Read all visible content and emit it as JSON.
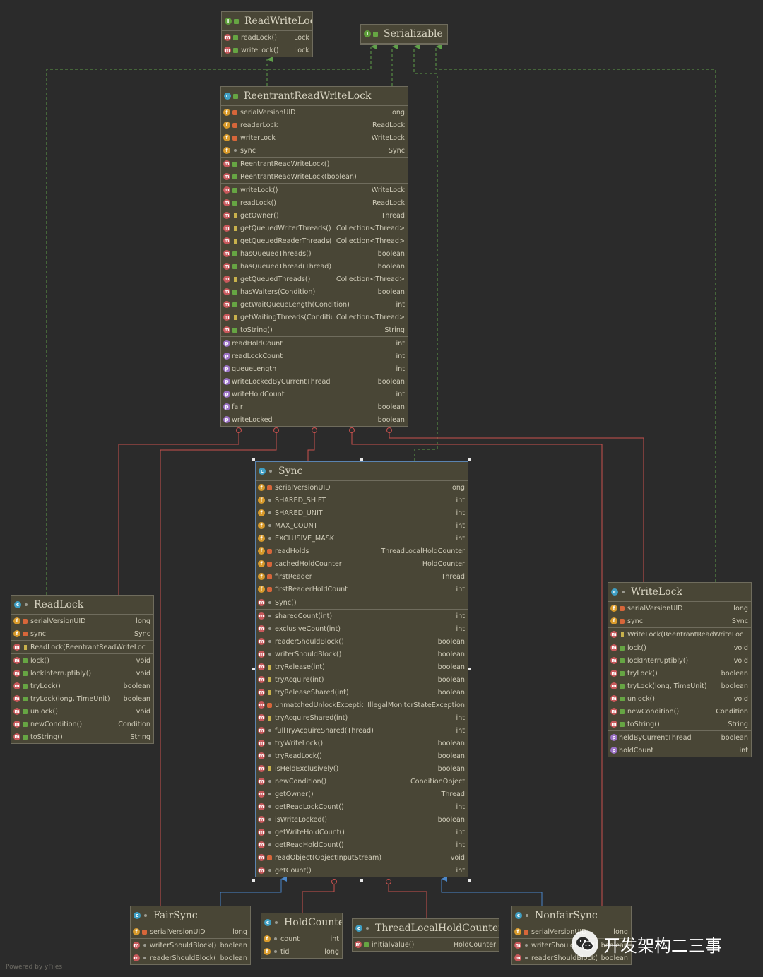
{
  "footer": "Powered by yFiles",
  "watermark": "开发架构二三事",
  "colors": {
    "background": "#2b2b2b",
    "box_fill": "#494636",
    "box_border": "#6f6c5d",
    "realize_edge": "#5f9f4a",
    "inner_edge": "#c9514e",
    "extends_edge": "#4a86c8"
  },
  "boxes": {
    "readwritelock": {
      "kind": "interface",
      "name": "ReadWriteLock",
      "sections": [
        [
          {
            "icon": "m",
            "vis": "pub",
            "label": "readLock()",
            "type": "Lock"
          },
          {
            "icon": "m",
            "vis": "pub",
            "label": "writeLock()",
            "type": "Lock"
          }
        ]
      ]
    },
    "serializable": {
      "kind": "interface",
      "name": "Serializable",
      "sections": []
    },
    "rrwl": {
      "kind": "class",
      "name": "ReentrantReadWriteLock",
      "sections": [
        [
          {
            "icon": "f",
            "vis": "priv",
            "label": "serialVersionUID",
            "type": "long"
          },
          {
            "icon": "f",
            "vis": "priv",
            "label": "readerLock",
            "type": "ReadLock"
          },
          {
            "icon": "f",
            "vis": "priv",
            "label": "writerLock",
            "type": "WriteLock"
          },
          {
            "icon": "f",
            "vis": "pack",
            "label": "sync",
            "type": "Sync"
          }
        ],
        [
          {
            "icon": "m",
            "vis": "pub",
            "label": "ReentrantReadWriteLock()",
            "type": ""
          },
          {
            "icon": "m",
            "vis": "pub",
            "label": "ReentrantReadWriteLock(boolean)",
            "type": ""
          }
        ],
        [
          {
            "icon": "m",
            "vis": "pub",
            "label": "writeLock()",
            "type": "WriteLock"
          },
          {
            "icon": "m",
            "vis": "pub",
            "label": "readLock()",
            "type": "ReadLock"
          },
          {
            "icon": "m",
            "vis": "prot",
            "label": "getOwner()",
            "type": "Thread"
          },
          {
            "icon": "m",
            "vis": "prot",
            "label": "getQueuedWriterThreads()",
            "type": "Collection<Thread>"
          },
          {
            "icon": "m",
            "vis": "prot",
            "label": "getQueuedReaderThreads()",
            "type": "Collection<Thread>"
          },
          {
            "icon": "m",
            "vis": "pub",
            "label": "hasQueuedThreads()",
            "type": "boolean"
          },
          {
            "icon": "m",
            "vis": "pub",
            "label": "hasQueuedThread(Thread)",
            "type": "boolean"
          },
          {
            "icon": "m",
            "vis": "prot",
            "label": "getQueuedThreads()",
            "type": "Collection<Thread>"
          },
          {
            "icon": "m",
            "vis": "pub",
            "label": "hasWaiters(Condition)",
            "type": "boolean"
          },
          {
            "icon": "m",
            "vis": "pub",
            "label": "getWaitQueueLength(Condition)",
            "type": "int"
          },
          {
            "icon": "m",
            "vis": "prot",
            "label": "getWaitingThreads(Condition)",
            "type": "Collection<Thread>"
          },
          {
            "icon": "m",
            "vis": "pub",
            "label": "toString()",
            "type": "String"
          }
        ],
        [
          {
            "icon": "p",
            "vis": "",
            "label": "readHoldCount",
            "type": "int"
          },
          {
            "icon": "p",
            "vis": "",
            "label": "readLockCount",
            "type": "int"
          },
          {
            "icon": "p",
            "vis": "",
            "label": "queueLength",
            "type": "int"
          },
          {
            "icon": "p",
            "vis": "",
            "label": "writeLockedByCurrentThread",
            "type": "boolean"
          },
          {
            "icon": "p",
            "vis": "",
            "label": "writeHoldCount",
            "type": "int"
          },
          {
            "icon": "p",
            "vis": "",
            "label": "fair",
            "type": "boolean"
          },
          {
            "icon": "p",
            "vis": "",
            "label": "writeLocked",
            "type": "boolean"
          }
        ]
      ]
    },
    "sync": {
      "kind": "class",
      "name": "Sync",
      "sections": [
        [
          {
            "icon": "f",
            "vis": "priv",
            "label": "serialVersionUID",
            "type": "long"
          },
          {
            "icon": "f",
            "vis": "pack",
            "label": "SHARED_SHIFT",
            "type": "int"
          },
          {
            "icon": "f",
            "vis": "pack",
            "label": "SHARED_UNIT",
            "type": "int"
          },
          {
            "icon": "f",
            "vis": "pack",
            "label": "MAX_COUNT",
            "type": "int"
          },
          {
            "icon": "f",
            "vis": "pack",
            "label": "EXCLUSIVE_MASK",
            "type": "int"
          },
          {
            "icon": "f",
            "vis": "priv",
            "label": "readHolds",
            "type": "ThreadLocalHoldCounter"
          },
          {
            "icon": "f",
            "vis": "priv",
            "label": "cachedHoldCounter",
            "type": "HoldCounter"
          },
          {
            "icon": "f",
            "vis": "priv",
            "label": "firstReader",
            "type": "Thread"
          },
          {
            "icon": "f",
            "vis": "priv",
            "label": "firstReaderHoldCount",
            "type": "int"
          }
        ],
        [
          {
            "icon": "m",
            "vis": "pack",
            "label": "Sync()",
            "type": ""
          }
        ],
        [
          {
            "icon": "m",
            "vis": "pack",
            "label": "sharedCount(int)",
            "type": "int"
          },
          {
            "icon": "m",
            "vis": "pack",
            "label": "exclusiveCount(int)",
            "type": "int"
          },
          {
            "icon": "m",
            "vis": "pack",
            "label": "readerShouldBlock()",
            "type": "boolean"
          },
          {
            "icon": "m",
            "vis": "pack",
            "label": "writerShouldBlock()",
            "type": "boolean"
          },
          {
            "icon": "m",
            "vis": "prot",
            "label": "tryRelease(int)",
            "type": "boolean"
          },
          {
            "icon": "m",
            "vis": "prot",
            "label": "tryAcquire(int)",
            "type": "boolean"
          },
          {
            "icon": "m",
            "vis": "prot",
            "label": "tryReleaseShared(int)",
            "type": "boolean"
          },
          {
            "icon": "m",
            "vis": "priv",
            "label": "unmatchedUnlockException()",
            "type": "IllegalMonitorStateException"
          },
          {
            "icon": "m",
            "vis": "prot",
            "label": "tryAcquireShared(int)",
            "type": "int"
          },
          {
            "icon": "m",
            "vis": "pack",
            "label": "fullTryAcquireShared(Thread)",
            "type": "int"
          },
          {
            "icon": "m",
            "vis": "pack",
            "label": "tryWriteLock()",
            "type": "boolean"
          },
          {
            "icon": "m",
            "vis": "pack",
            "label": "tryReadLock()",
            "type": "boolean"
          },
          {
            "icon": "m",
            "vis": "prot",
            "label": "isHeldExclusively()",
            "type": "boolean"
          },
          {
            "icon": "m",
            "vis": "pack",
            "label": "newCondition()",
            "type": "ConditionObject"
          },
          {
            "icon": "m",
            "vis": "pack",
            "label": "getOwner()",
            "type": "Thread"
          },
          {
            "icon": "m",
            "vis": "pack",
            "label": "getReadLockCount()",
            "type": "int"
          },
          {
            "icon": "m",
            "vis": "pack",
            "label": "isWriteLocked()",
            "type": "boolean"
          },
          {
            "icon": "m",
            "vis": "pack",
            "label": "getWriteHoldCount()",
            "type": "int"
          },
          {
            "icon": "m",
            "vis": "pack",
            "label": "getReadHoldCount()",
            "type": "int"
          },
          {
            "icon": "m",
            "vis": "priv",
            "label": "readObject(ObjectInputStream)",
            "type": "void"
          },
          {
            "icon": "m",
            "vis": "pack",
            "label": "getCount()",
            "type": "int"
          }
        ]
      ]
    },
    "readlock": {
      "kind": "class",
      "name": "ReadLock",
      "sections": [
        [
          {
            "icon": "f",
            "vis": "priv",
            "label": "serialVersionUID",
            "type": "long"
          },
          {
            "icon": "f",
            "vis": "priv",
            "label": "sync",
            "type": "Sync"
          }
        ],
        [
          {
            "icon": "m",
            "vis": "prot",
            "label": "ReadLock(ReentrantReadWriteLock)",
            "type": ""
          }
        ],
        [
          {
            "icon": "m",
            "vis": "pub",
            "label": "lock()",
            "type": "void"
          },
          {
            "icon": "m",
            "vis": "pub",
            "label": "lockInterruptibly()",
            "type": "void"
          },
          {
            "icon": "m",
            "vis": "pub",
            "label": "tryLock()",
            "type": "boolean"
          },
          {
            "icon": "m",
            "vis": "pub",
            "label": "tryLock(long, TimeUnit)",
            "type": "boolean"
          },
          {
            "icon": "m",
            "vis": "pub",
            "label": "unlock()",
            "type": "void"
          },
          {
            "icon": "m",
            "vis": "pub",
            "label": "newCondition()",
            "type": "Condition"
          },
          {
            "icon": "m",
            "vis": "pub",
            "label": "toString()",
            "type": "String"
          }
        ]
      ]
    },
    "writelock": {
      "kind": "class",
      "name": "WriteLock",
      "sections": [
        [
          {
            "icon": "f",
            "vis": "priv",
            "label": "serialVersionUID",
            "type": "long"
          },
          {
            "icon": "f",
            "vis": "priv",
            "label": "sync",
            "type": "Sync"
          }
        ],
        [
          {
            "icon": "m",
            "vis": "prot",
            "label": "WriteLock(ReentrantReadWriteLock)",
            "type": ""
          }
        ],
        [
          {
            "icon": "m",
            "vis": "pub",
            "label": "lock()",
            "type": "void"
          },
          {
            "icon": "m",
            "vis": "pub",
            "label": "lockInterruptibly()",
            "type": "void"
          },
          {
            "icon": "m",
            "vis": "pub",
            "label": "tryLock()",
            "type": "boolean"
          },
          {
            "icon": "m",
            "vis": "pub",
            "label": "tryLock(long, TimeUnit)",
            "type": "boolean"
          },
          {
            "icon": "m",
            "vis": "pub",
            "label": "unlock()",
            "type": "void"
          },
          {
            "icon": "m",
            "vis": "pub",
            "label": "newCondition()",
            "type": "Condition"
          },
          {
            "icon": "m",
            "vis": "pub",
            "label": "toString()",
            "type": "String"
          }
        ],
        [
          {
            "icon": "p",
            "vis": "",
            "label": "heldByCurrentThread",
            "type": "boolean"
          },
          {
            "icon": "p",
            "vis": "",
            "label": "holdCount",
            "type": "int"
          }
        ]
      ]
    },
    "fairsync": {
      "kind": "class",
      "name": "FairSync",
      "sections": [
        [
          {
            "icon": "f",
            "vis": "priv",
            "label": "serialVersionUID",
            "type": "long"
          }
        ],
        [
          {
            "icon": "m",
            "vis": "pack",
            "label": "writerShouldBlock()",
            "type": "boolean"
          },
          {
            "icon": "m",
            "vis": "pack",
            "label": "readerShouldBlock()",
            "type": "boolean"
          }
        ]
      ]
    },
    "holdcounter": {
      "kind": "class",
      "name": "HoldCounter",
      "sections": [
        [
          {
            "icon": "f",
            "vis": "pack",
            "label": "count",
            "type": "int"
          },
          {
            "icon": "f",
            "vis": "pack",
            "label": "tid",
            "type": "long"
          }
        ]
      ]
    },
    "tlhc": {
      "kind": "class",
      "name": "ThreadLocalHoldCounter",
      "sections": [
        [
          {
            "icon": "m",
            "vis": "pub",
            "label": "initialValue()",
            "type": "HoldCounter"
          }
        ]
      ]
    },
    "nonfairsync": {
      "kind": "class",
      "name": "NonfairSync",
      "sections": [
        [
          {
            "icon": "f",
            "vis": "priv",
            "label": "serialVersionUID",
            "type": "long"
          }
        ],
        [
          {
            "icon": "m",
            "vis": "pack",
            "label": "writerShouldBlock()",
            "type": "boolean"
          },
          {
            "icon": "m",
            "vis": "pack",
            "label": "readerShouldBlock()",
            "type": "boolean"
          }
        ]
      ]
    }
  }
}
